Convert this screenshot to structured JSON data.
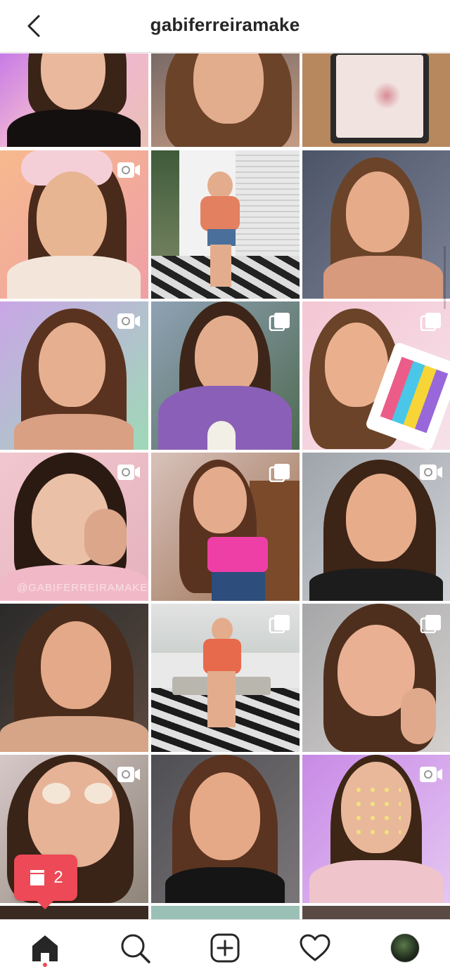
{
  "header": {
    "username": "gabiferreiramake"
  },
  "icons": {
    "back": "chevron-left-icon",
    "home": "home-icon",
    "search": "search-icon",
    "new_post": "plus-square-icon",
    "activity": "heart-icon",
    "profile": "avatar",
    "video_badge": "video-camera-icon",
    "carousel_badge": "multiple-images-icon",
    "notification": "post-stack-icon"
  },
  "notification": {
    "count": "2"
  },
  "grid": {
    "watermark": "@GABIFERREIRAMAKE",
    "tiles": [
      {
        "badge": "none"
      },
      {
        "badge": "none"
      },
      {
        "badge": "none"
      },
      {
        "badge": "video"
      },
      {
        "badge": "none"
      },
      {
        "badge": "none"
      },
      {
        "badge": "video"
      },
      {
        "badge": "carousel"
      },
      {
        "badge": "carousel"
      },
      {
        "badge": "video"
      },
      {
        "badge": "carousel"
      },
      {
        "badge": "video"
      },
      {
        "badge": "none"
      },
      {
        "badge": "carousel"
      },
      {
        "badge": "carousel"
      },
      {
        "badge": "video"
      },
      {
        "badge": "none"
      },
      {
        "badge": "video"
      }
    ]
  },
  "colors": {
    "accent": "#ed4956",
    "text": "#262626",
    "divider": "#dbdbdb"
  }
}
